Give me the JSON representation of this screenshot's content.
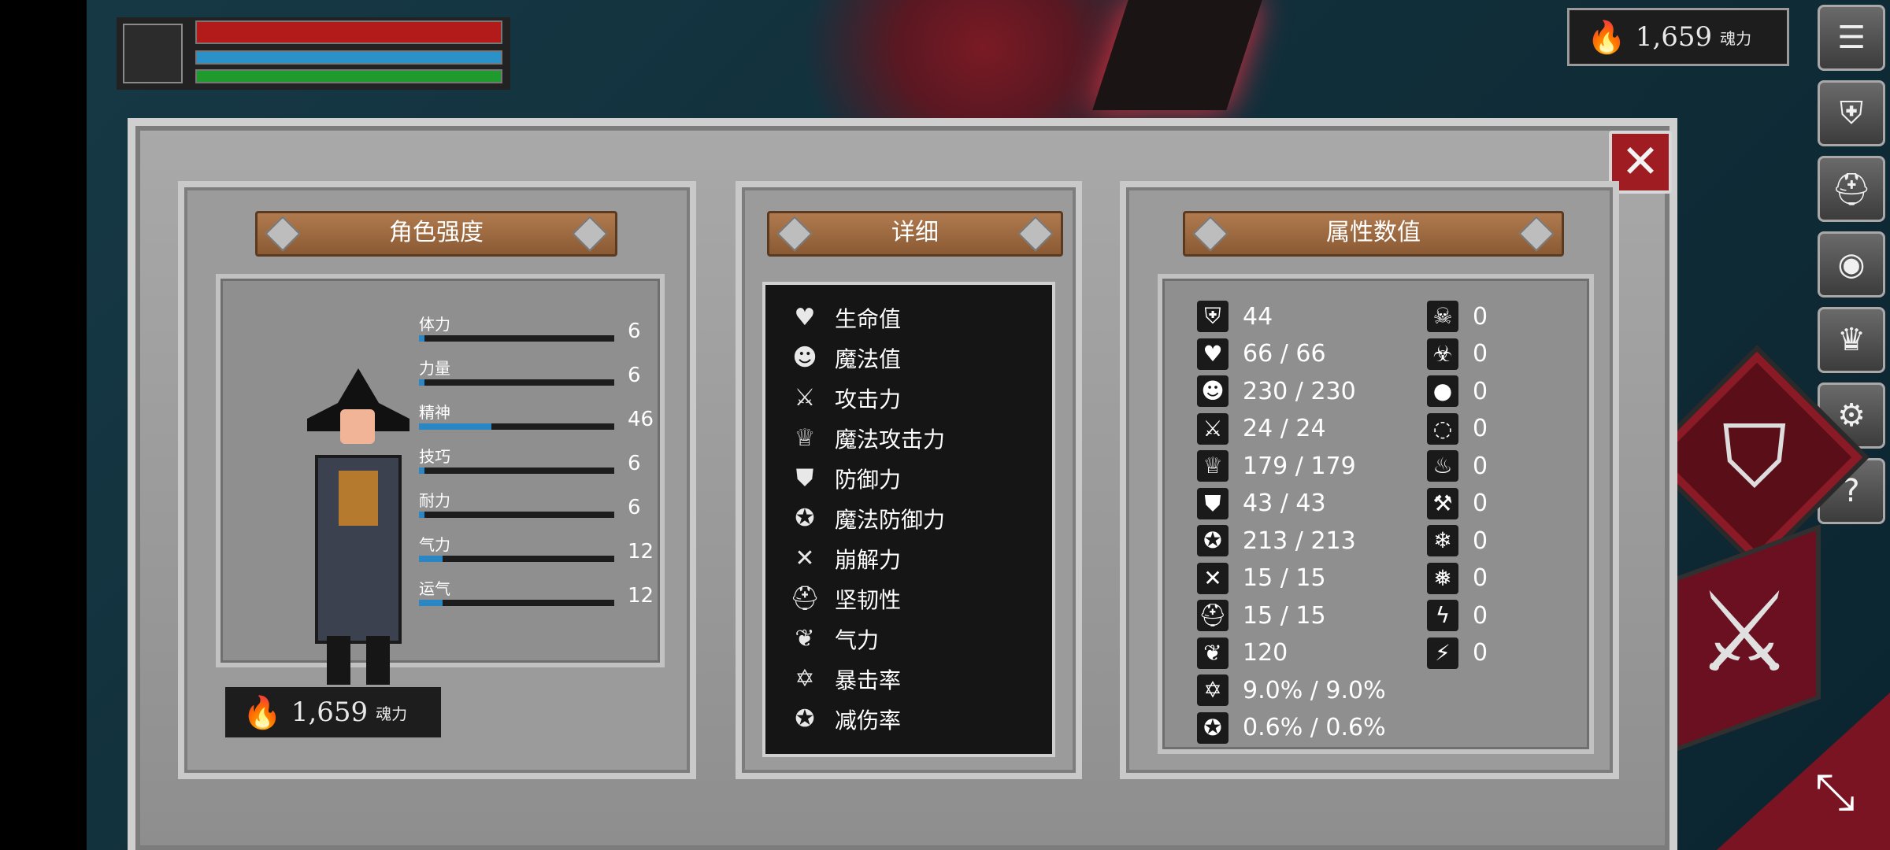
{
  "hud": {
    "hp_color": "#b31a1a",
    "mp_color": "#2b91c9",
    "stamina_color": "#1f9a2c"
  },
  "currency": {
    "amount": "1,659",
    "unit": "魂力",
    "icon": "flame-icon"
  },
  "side_menu": [
    {
      "name": "menu-icon",
      "glyph": "☰"
    },
    {
      "name": "armor-icon",
      "glyph": "⛨"
    },
    {
      "name": "helmet-icon",
      "glyph": "⛑"
    },
    {
      "name": "emblem-icon",
      "glyph": "◉"
    },
    {
      "name": "crown-icon",
      "glyph": "♛"
    },
    {
      "name": "gear-icon",
      "glyph": "⚙"
    },
    {
      "name": "help-icon",
      "glyph": "?"
    }
  ],
  "panels": {
    "character_title": "角色强度",
    "details_title": "详细",
    "stats_title": "属性数值"
  },
  "attributes": [
    {
      "label": "体力",
      "value": "6",
      "fill": 0.03
    },
    {
      "label": "力量",
      "value": "6",
      "fill": 0.03
    },
    {
      "label": "精神",
      "value": "46",
      "fill": 0.37
    },
    {
      "label": "技巧",
      "value": "6",
      "fill": 0.03
    },
    {
      "label": "耐力",
      "value": "6",
      "fill": 0.03
    },
    {
      "label": "气力",
      "value": "12",
      "fill": 0.12
    },
    {
      "label": "运气",
      "value": "12",
      "fill": 0.12
    }
  ],
  "details": [
    {
      "label": "生命值",
      "icon": "heart-icon",
      "glyph": "♥"
    },
    {
      "label": "魔法值",
      "icon": "head-icon",
      "glyph": "☻"
    },
    {
      "label": "攻击力",
      "icon": "sword-icon",
      "glyph": "⚔"
    },
    {
      "label": "魔法攻击力",
      "icon": "magic-attack-icon",
      "glyph": "♕"
    },
    {
      "label": "防御力",
      "icon": "shield-icon",
      "glyph": "⛊"
    },
    {
      "label": "魔法防御力",
      "icon": "magic-defense-icon",
      "glyph": "✪"
    },
    {
      "label": "崩解力",
      "icon": "break-icon",
      "glyph": "✕"
    },
    {
      "label": "坚韧性",
      "icon": "helm-icon",
      "glyph": "⛑"
    },
    {
      "label": "气力",
      "icon": "lungs-icon",
      "glyph": "❦"
    },
    {
      "label": "暴击率",
      "icon": "critical-icon",
      "glyph": "✡"
    },
    {
      "label": "减伤率",
      "icon": "damage-reduction-icon",
      "glyph": "✪"
    }
  ],
  "stats_left": [
    "44",
    "66 / 66",
    "230 / 230",
    "24 / 24",
    "179 / 179",
    "43 / 43",
    "213 / 213",
    "15 / 15",
    "15 / 15",
    "120",
    "9.0% / 9.0%",
    "0.6% / 0.6%"
  ],
  "stats_left_icons": [
    "armor-icon",
    "heart-icon",
    "head-icon",
    "sword-icon",
    "magic-attack-icon",
    "shield-icon",
    "magic-defense-icon",
    "break-icon",
    "helm-icon",
    "lungs-icon",
    "critical-icon",
    "damage-reduction-icon"
  ],
  "stats_right": [
    "0",
    "0",
    "0",
    "0",
    "0",
    "0",
    "0",
    "0",
    "0",
    "0"
  ],
  "stats_right_icons": [
    "skull-icon",
    "poison-icon",
    "blood-icon",
    "bleed-resist-icon",
    "fire-icon",
    "fire-resist-icon",
    "frost-icon",
    "frost-resist-icon",
    "lightning-icon",
    "lightning-resist-icon"
  ]
}
